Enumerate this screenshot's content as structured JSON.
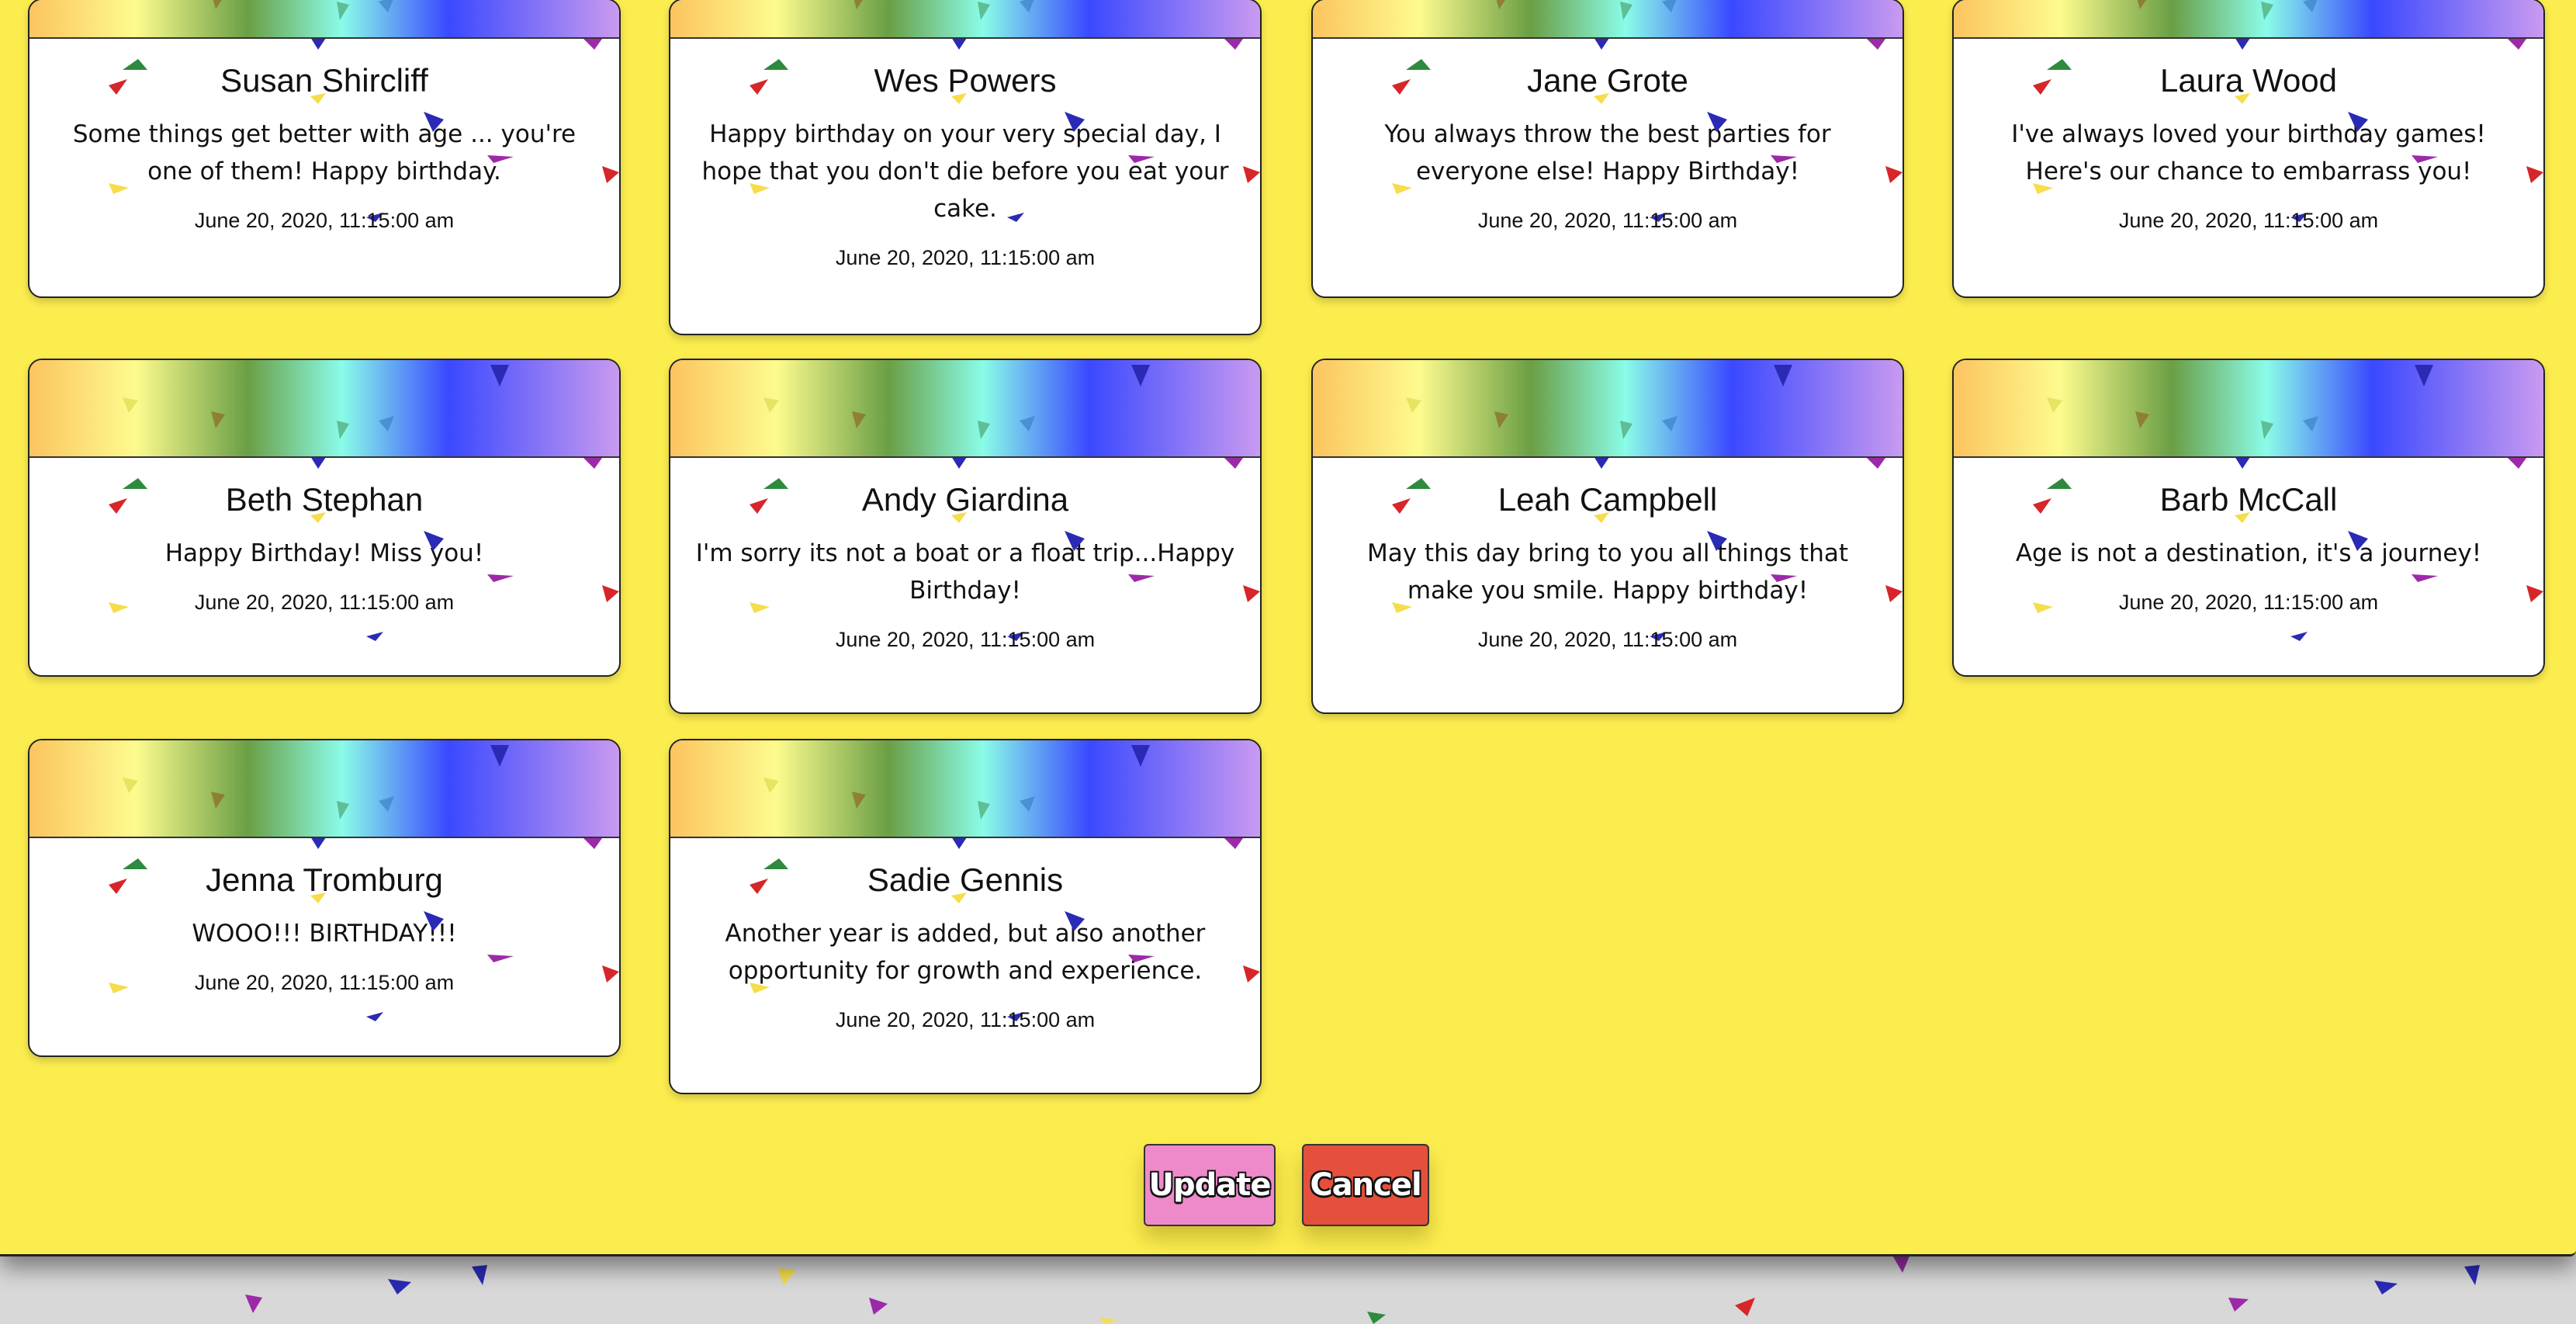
{
  "cards": [
    {
      "name": "Susan Shircliff",
      "message": "Some things get better with age ... you're one of them! Happy birthday.",
      "date": "June 20, 2020, 11:15:00 am"
    },
    {
      "name": "Wes Powers",
      "message": "Happy birthday on your very special day, I hope that you don't die before you eat your cake.",
      "date": "June 20, 2020, 11:15:00 am"
    },
    {
      "name": "Jane Grote",
      "message": "You always throw the best parties for everyone else! Happy Birthday!",
      "date": "June 20, 2020, 11:15:00 am"
    },
    {
      "name": "Laura Wood",
      "message": "I've always loved your birthday games! Here's our chance to embarrass you!",
      "date": "June 20, 2020, 11:15:00 am"
    },
    {
      "name": "Beth Stephan",
      "message": "Happy Birthday! Miss you!",
      "date": "June 20, 2020, 11:15:00 am"
    },
    {
      "name": "Andy Giardina",
      "message": "I'm sorry its not a boat or a float trip...Happy Birthday!",
      "date": "June 20, 2020, 11:15:00 am"
    },
    {
      "name": "Leah Campbell",
      "message": "May this day bring to you all things that make you smile. Happy birthday!",
      "date": "June 20, 2020, 11:15:00 am"
    },
    {
      "name": "Barb McCall",
      "message": "Age is not a destination, it's a journey!",
      "date": "June 20, 2020, 11:15:00 am"
    },
    {
      "name": "Jenna Tromburg",
      "message": "WOOO!!! BIRTHDAY!!!",
      "date": "June 20, 2020, 11:15:00 am"
    },
    {
      "name": "Sadie Gennis",
      "message": "Another year is added, but also another opportunity for growth and experience.",
      "date": "June 20, 2020, 11:15:00 am"
    }
  ],
  "actions": {
    "update_label": "Update",
    "cancel_label": "Cancel"
  },
  "colors": {
    "page_background": "#fced4f",
    "update_button": "#ee8ac9",
    "cancel_button": "#e4503c",
    "confetti": [
      "#2e8a3e",
      "#d6262a",
      "#f5dd4c",
      "#2a2ab5",
      "#9c2aa8"
    ]
  },
  "icons": [
    "confetti-decoration"
  ]
}
